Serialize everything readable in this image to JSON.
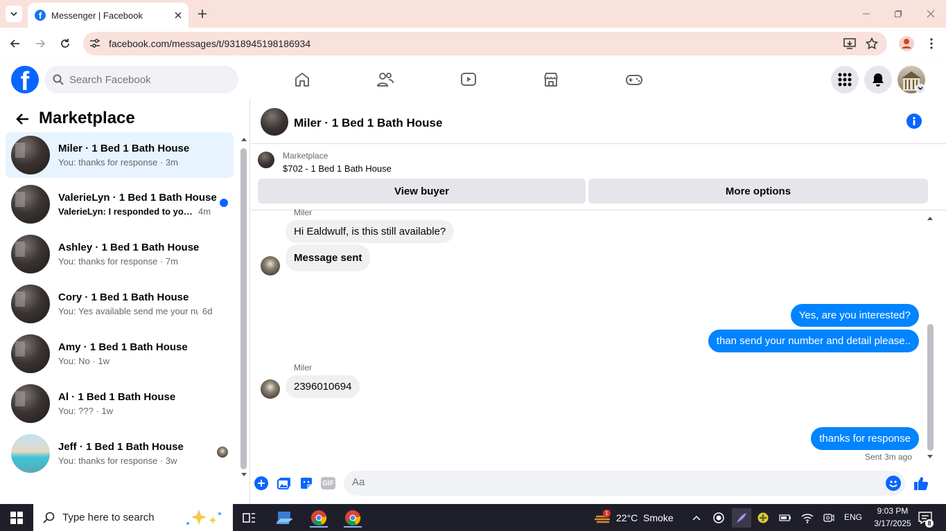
{
  "browser": {
    "tab_title": "Messenger | Facebook",
    "url": "facebook.com/messages/t/9318945198186934"
  },
  "fb": {
    "search_placeholder": "Search Facebook"
  },
  "left": {
    "title": "Marketplace",
    "conversations": [
      {
        "name": "Miler · 1 Bed 1 Bath House",
        "preview": "You: thanks for response",
        "time": "3m",
        "active": true
      },
      {
        "name": "ValerieLyn · 1 Bed 1 Bath House",
        "preview": "ValerieLyn: I responded to your ...",
        "time": "4m",
        "unread": true
      },
      {
        "name": "Ashley · 1 Bed 1 Bath House",
        "preview": "You: thanks for response",
        "time": "7m"
      },
      {
        "name": "Cory · 1 Bed 1 Bath House",
        "preview": "You: Yes available send me your nu...",
        "time": "6d"
      },
      {
        "name": "Amy · 1 Bed 1 Bath House",
        "preview": "You: No",
        "time": "1w"
      },
      {
        "name": "Al · 1 Bed 1 Bath House",
        "preview": "You: ???",
        "time": "1w"
      },
      {
        "name": "Jeff · 1 Bed 1 Bath House",
        "preview": "You: thanks for response",
        "time": "3w"
      }
    ]
  },
  "chat": {
    "title": "Miler · 1 Bed 1 Bath House",
    "listing_label": "Marketplace",
    "listing_price": "$702 - 1 Bed 1 Bath House",
    "view_buyer": "View buyer",
    "more_options": "More options",
    "sender_top": "Miler",
    "msg1": "Hi Ealdwulf, is this still available?",
    "msg2": "Message sent",
    "out1": "Yes, are you interested?",
    "out2": "than send your number and detail please..",
    "sender2": "Miler",
    "msg3": "2396010694",
    "out3": "thanks for response",
    "status": "Sent 3m ago",
    "composer_placeholder": "Aa",
    "gif_label": "GIF"
  },
  "taskbar": {
    "search_placeholder": "Type here to search",
    "weather": "22°C  Smoke",
    "weather_badge": "1",
    "lang": "ENG",
    "time": "9:03 PM",
    "date": "3/17/2025",
    "notif_count": "8"
  }
}
